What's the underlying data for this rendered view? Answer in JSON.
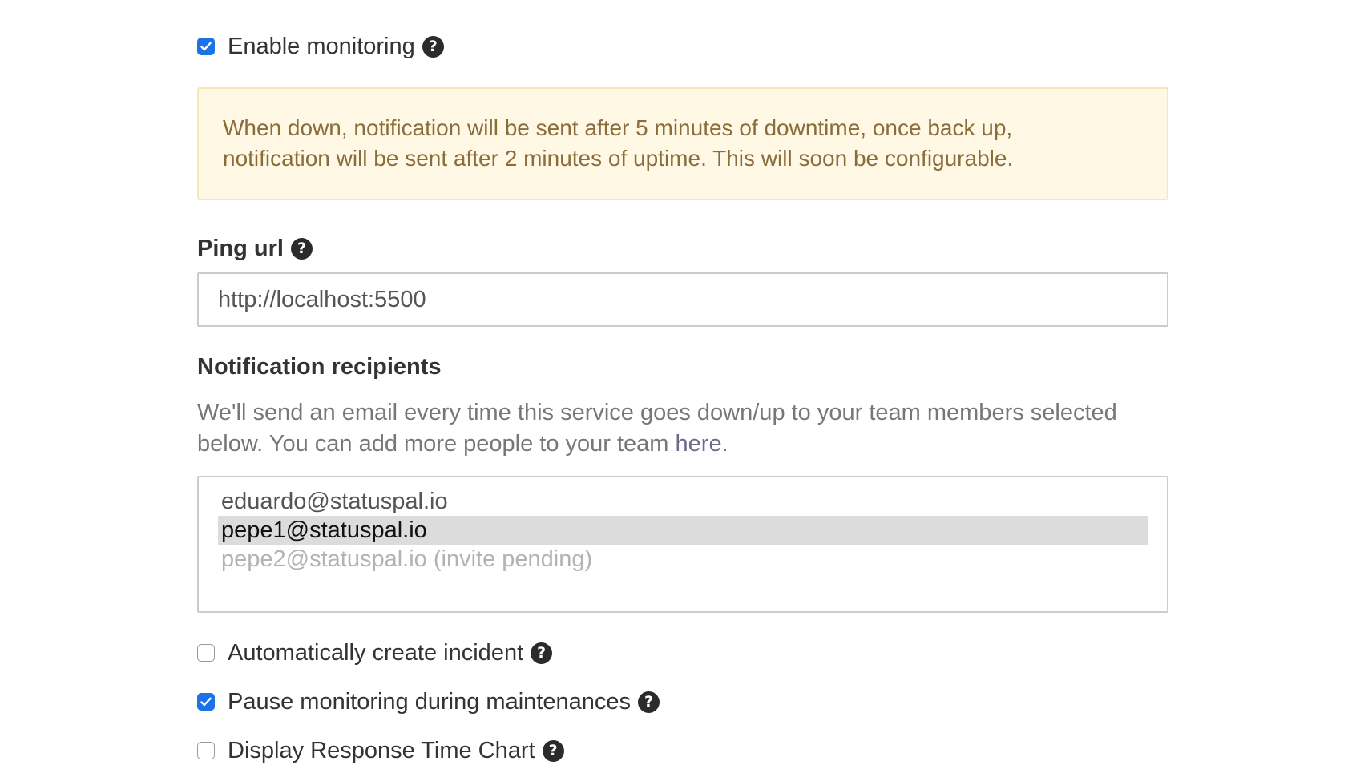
{
  "enable_monitoring": {
    "label": "Enable monitoring",
    "checked": true,
    "help_icon": "question-circle-icon"
  },
  "alert": {
    "text_line1": "When down, notification will be sent after 5 minutes of downtime, once back up,",
    "text_line2": "notification will be sent after 2 minutes of uptime. This will soon be configurable."
  },
  "ping_url": {
    "label": "Ping url",
    "value": "http://localhost:5500",
    "help_icon": "question-circle-icon"
  },
  "notification_recipients": {
    "label": "Notification recipients",
    "help_text_before_link": "We'll send an email every time this service goes down/up to your team members selected below. You can add more people to your team ",
    "help_link": "here",
    "help_text_after_link": ".",
    "options": [
      {
        "label": "eduardo@statuspal.io",
        "state": "normal"
      },
      {
        "label": "pepe1@statuspal.io",
        "state": "selected"
      },
      {
        "label": "pepe2@statuspal.io (invite pending)",
        "state": "disabled"
      }
    ]
  },
  "auto_create_incident": {
    "label": "Automatically create incident",
    "checked": false,
    "help_icon": "question-circle-icon"
  },
  "pause_during_maintenances": {
    "label": "Pause monitoring during maintenances",
    "checked": true,
    "help_icon": "question-circle-icon"
  },
  "display_response_time_chart": {
    "label": "Display Response Time Chart",
    "checked": false,
    "help_icon": "question-circle-icon"
  },
  "colors": {
    "checkbox_accent": "#1b73e8",
    "alert_background": "#fef8e4",
    "alert_border": "#f7e7b5",
    "alert_text": "#8a6d3b",
    "selected_option_background": "#dcdcdc"
  },
  "help_icon_glyph": "?"
}
